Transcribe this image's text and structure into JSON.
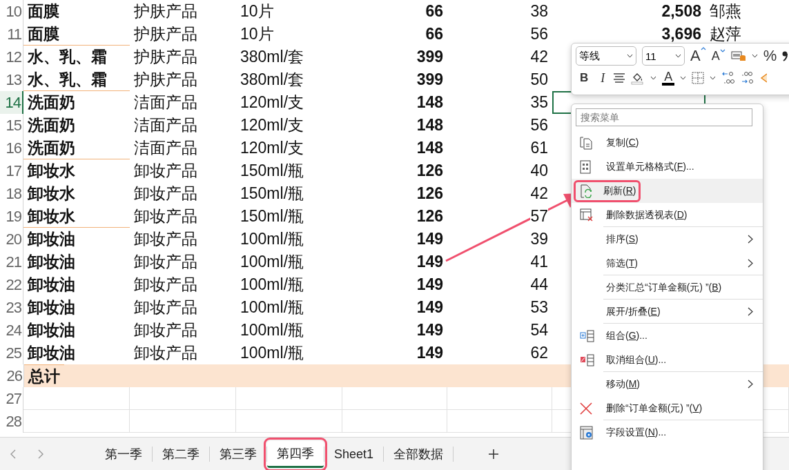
{
  "sheet": {
    "rows": [
      {
        "num": "10",
        "cells": [
          "面膜",
          "护肤产品",
          "10片",
          "66",
          "38",
          "2,508",
          "邹燕"
        ],
        "group_end": false,
        "active": false
      },
      {
        "num": "11",
        "cells": [
          "面膜",
          "护肤产品",
          "10片",
          "66",
          "56",
          "3,696",
          "赵萍"
        ],
        "group_end": true,
        "active": false
      },
      {
        "num": "12",
        "cells": [
          "水、乳、霜",
          "护肤产品",
          "380ml/套",
          "399",
          "42"
        ],
        "group_end": false,
        "active": false
      },
      {
        "num": "13",
        "cells": [
          "水、乳、霜",
          "护肤产品",
          "380ml/套",
          "399",
          "50"
        ],
        "group_end": true,
        "active": false
      },
      {
        "num": "14",
        "cells": [
          "洗面奶",
          "洁面产品",
          "120ml/支",
          "148",
          "35"
        ],
        "group_end": false,
        "active": true
      },
      {
        "num": "15",
        "cells": [
          "洗面奶",
          "洁面产品",
          "120ml/支",
          "148",
          "56"
        ],
        "group_end": false,
        "active": false
      },
      {
        "num": "16",
        "cells": [
          "洗面奶",
          "洁面产品",
          "120ml/支",
          "148",
          "61"
        ],
        "group_end": true,
        "active": false
      },
      {
        "num": "17",
        "cells": [
          "卸妆水",
          "卸妆产品",
          "150ml/瓶",
          "126",
          "40"
        ],
        "group_end": false,
        "active": false
      },
      {
        "num": "18",
        "cells": [
          "卸妆水",
          "卸妆产品",
          "150ml/瓶",
          "126",
          "42"
        ],
        "group_end": false,
        "active": false
      },
      {
        "num": "19",
        "cells": [
          "卸妆水",
          "卸妆产品",
          "150ml/瓶",
          "126",
          "57"
        ],
        "group_end": true,
        "active": false
      },
      {
        "num": "20",
        "cells": [
          "卸妆油",
          "卸妆产品",
          "100ml/瓶",
          "149",
          "39"
        ],
        "group_end": false,
        "active": false
      },
      {
        "num": "21",
        "cells": [
          "卸妆油",
          "卸妆产品",
          "100ml/瓶",
          "149",
          "41"
        ],
        "group_end": false,
        "active": false
      },
      {
        "num": "22",
        "cells": [
          "卸妆油",
          "卸妆产品",
          "100ml/瓶",
          "149",
          "44"
        ],
        "group_end": false,
        "active": false
      },
      {
        "num": "23",
        "cells": [
          "卸妆油",
          "卸妆产品",
          "100ml/瓶",
          "149",
          "53"
        ],
        "group_end": false,
        "active": false
      },
      {
        "num": "24",
        "cells": [
          "卸妆油",
          "卸妆产品",
          "100ml/瓶",
          "149",
          "54"
        ],
        "group_end": false,
        "active": false
      },
      {
        "num": "25",
        "cells": [
          "卸妆油",
          "卸妆产品",
          "100ml/瓶",
          "149",
          "62"
        ],
        "group_end": false,
        "active": false
      }
    ],
    "total": {
      "num": "26",
      "label": "总计"
    },
    "empty_rows": [
      "27",
      "28"
    ]
  },
  "mini_toolbar": {
    "font": "等线",
    "size": "11",
    "bold": "B",
    "italic": "I",
    "font_color": "A",
    "grow": "A",
    "shrink": "A",
    "percent": "%"
  },
  "context_menu": {
    "search_placeholder": "搜索菜单",
    "items": [
      {
        "kind": "copy",
        "text": "复制(",
        "key": "C",
        "tail": ")",
        "submenu": false,
        "hover": false,
        "highlighted": false,
        "divider_after": false
      },
      {
        "kind": "format",
        "text": "设置单元格格式(",
        "key": "F",
        "tail": ")...",
        "submenu": false,
        "hover": false,
        "highlighted": false,
        "divider_after": false
      },
      {
        "kind": "refresh",
        "text": "刷新(",
        "key": "R",
        "tail": ")",
        "submenu": false,
        "hover": true,
        "highlighted": true,
        "divider_after": false
      },
      {
        "kind": "droptable",
        "text": "删除数据透视表(",
        "key": "D",
        "tail": ")",
        "submenu": false,
        "hover": false,
        "highlighted": false,
        "divider_after": true
      },
      {
        "kind": "plain",
        "text": "排序(",
        "key": "S",
        "tail": ")",
        "submenu": true,
        "hover": false,
        "highlighted": false,
        "divider_after": false
      },
      {
        "kind": "plain",
        "text": "筛选(",
        "key": "T",
        "tail": ")",
        "submenu": true,
        "hover": false,
        "highlighted": false,
        "divider_after": true
      },
      {
        "kind": "plain",
        "text": "分类汇总“订单金额(元) ”(",
        "key": "B",
        "tail": ")",
        "submenu": false,
        "hover": false,
        "highlighted": false,
        "divider_after": true
      },
      {
        "kind": "plain",
        "text": "展开/折叠(",
        "key": "E",
        "tail": ")",
        "submenu": true,
        "hover": false,
        "highlighted": false,
        "divider_after": true
      },
      {
        "kind": "group",
        "text": "组合(",
        "key": "G",
        "tail": ")...",
        "submenu": false,
        "hover": false,
        "highlighted": false,
        "divider_after": false
      },
      {
        "kind": "ungroup",
        "text": "取消组合(",
        "key": "U",
        "tail": ")...",
        "submenu": false,
        "hover": false,
        "highlighted": false,
        "divider_after": true
      },
      {
        "kind": "plain",
        "text": "移动(",
        "key": "M",
        "tail": ")",
        "submenu": true,
        "hover": false,
        "highlighted": false,
        "divider_after": false
      },
      {
        "kind": "remove",
        "text": "删除“订单金额(元) ”(",
        "key": "V",
        "tail": ")",
        "submenu": false,
        "hover": false,
        "highlighted": false,
        "divider_after": true
      },
      {
        "kind": "fieldsettings",
        "text": "字段设置(",
        "key": "N",
        "tail": ")...",
        "submenu": false,
        "hover": false,
        "highlighted": false,
        "divider_after": false
      }
    ]
  },
  "sheet_tabs": [
    {
      "label": "第一季",
      "selected": false,
      "highlighted": false
    },
    {
      "label": "第二季",
      "selected": false,
      "highlighted": false
    },
    {
      "label": "第三季",
      "selected": false,
      "highlighted": false
    },
    {
      "label": "第四季",
      "selected": true,
      "highlighted": true
    },
    {
      "label": "Sheet1",
      "selected": false,
      "highlighted": false
    },
    {
      "label": "全部数据",
      "selected": false,
      "highlighted": false
    }
  ]
}
